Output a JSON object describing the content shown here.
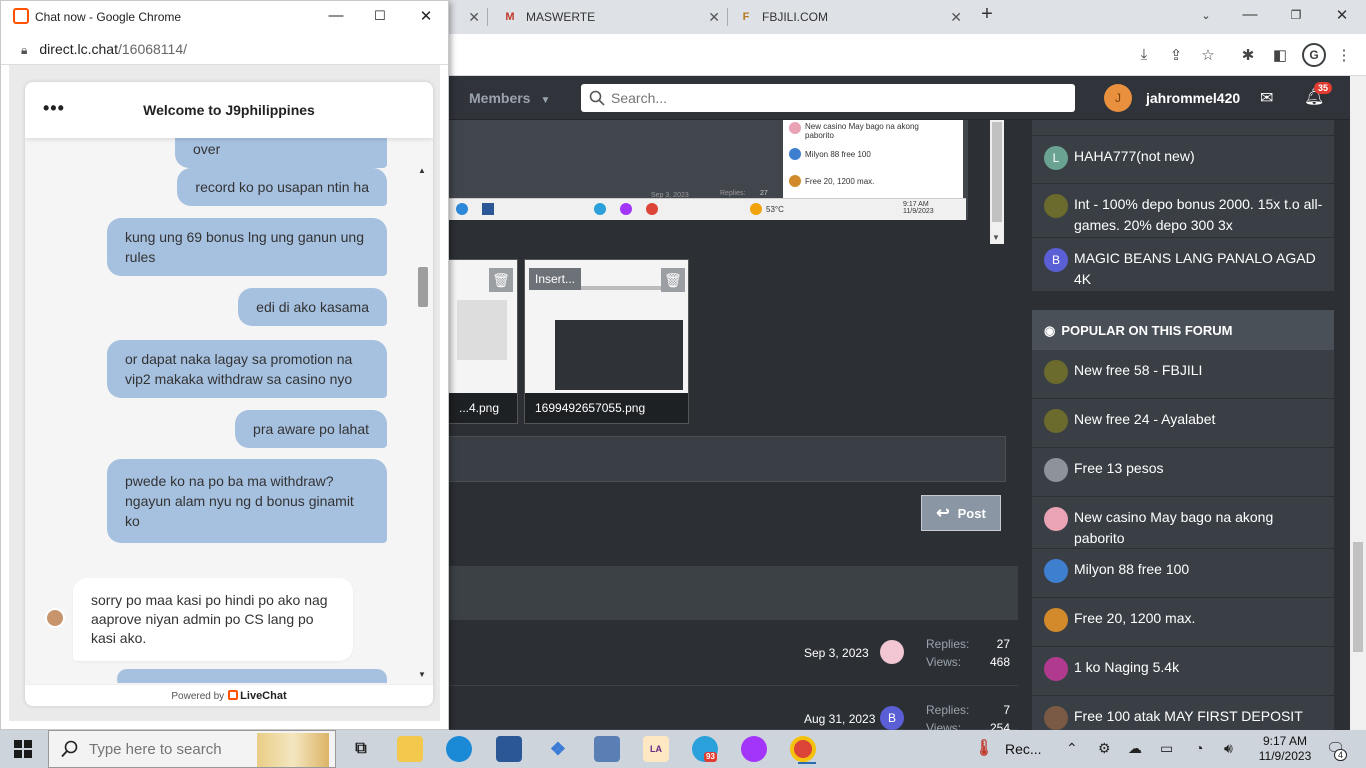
{
  "browser": {
    "tabs": [
      {
        "label": "MASWERTE",
        "favicon": "M"
      },
      {
        "label": "FBJILI.COM",
        "favicon": "F"
      }
    ],
    "profile_initial": "G"
  },
  "forum": {
    "nav_members": "Members",
    "search_placeholder": "Search...",
    "user_initial": "J",
    "username": "jahrommel420",
    "alerts_count": "35",
    "screenshot_thumb": {
      "items": [
        "New casino May bago na akong paborito",
        "Milyon 88 free 100",
        "Free 20, 1200 max."
      ],
      "date": "Sep 3, 2023",
      "replies": "Replies:",
      "replies_val": "27",
      "temp": "53°C",
      "time": "9:17 AM",
      "date2": "11/9/2023"
    },
    "attachments": [
      {
        "name": "...4.png"
      },
      {
        "name": "1699492657055.png",
        "insert_label": "Insert..."
      }
    ],
    "post_button": "Post",
    "threads": [
      {
        "date": "Sep 3, 2023",
        "avatar": "",
        "replies_label": "Replies:",
        "replies": "27",
        "views_label": "Views:",
        "views": "468"
      },
      {
        "date": "Aug 31, 2023",
        "avatar": "B",
        "replies_label": "Replies:",
        "replies": "7",
        "views_label": "Views:",
        "views": "254"
      }
    ],
    "sidebar_latest": [
      {
        "avatar": "L",
        "color": "#6aa392",
        "title": "HAHA777(not new)"
      },
      {
        "avatar": "",
        "color": "#6b6b2e",
        "title": "Int - 100% depo bonus 2000. 15x t.o all-games. 20% depo 300 3x"
      },
      {
        "avatar": "B",
        "color": "#5b5fd6",
        "title": "MAGIC BEANS LANG PANALO AGAD 4K"
      }
    ],
    "popular_title": "POPULAR ON THIS FORUM",
    "sidebar_popular": [
      {
        "color": "#6b6b2e",
        "title": "New free 58 - FBJILI"
      },
      {
        "color": "#6b6b2e",
        "title": "New free 24 - Ayalabet"
      },
      {
        "color": "#8e9399",
        "title": "Free 13 pesos"
      },
      {
        "color": "#e9a3b5",
        "title": "New casino May bago na akong paborito"
      },
      {
        "color": "#3e7fd0",
        "title": "Milyon 88 free 100"
      },
      {
        "color": "#d38a2b",
        "title": "Free 20, 1200 max."
      },
      {
        "color": "#b03a8e",
        "title": "1 ko Naging 5.4k"
      },
      {
        "color": "#7a5a44",
        "title": "Free 100 atak MAY FIRST DEPOSIT"
      }
    ]
  },
  "chat": {
    "window_title": "Chat now - Google Chrome",
    "url_host": "direct.lc.chat",
    "url_path": "/16068114/",
    "header_title": "Welcome to J9philippines",
    "menu": "•••",
    "messages": [
      "nilampasan ko ung turn over",
      "record ko po usapan ntin ha",
      "kung ung 69 bonus lng ung ganun ung rules",
      "edi di ako kasama",
      "or dapat naka lagay sa promotion na vip2 makaka withdraw sa casino nyo",
      "pra aware po lahat",
      "pwede ko na po ba ma withdraw? ngayun alam nyu ng d bonus ginamit ko"
    ],
    "agent_message": "sorry po maa kasi po hindi po ako nag aaprove niyan admin po CS lang po kasi ako.",
    "powered_by": "Powered by",
    "brand": "LiveChat"
  },
  "taskbar": {
    "search_placeholder": "Type here to search",
    "rec_label": "Rec...",
    "telegram_badge": "93",
    "time": "9:17 AM",
    "date": "11/9/2023",
    "notifications": "4"
  }
}
